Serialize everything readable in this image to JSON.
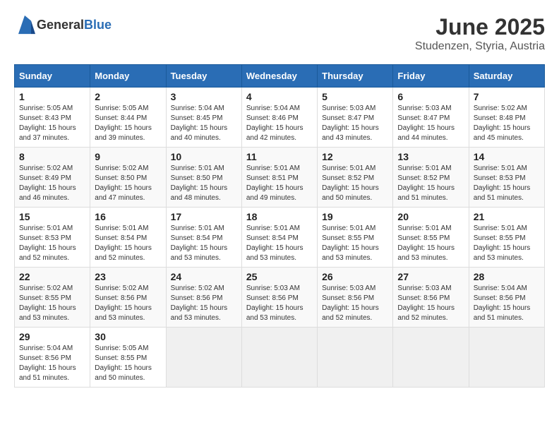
{
  "header": {
    "logo_general": "General",
    "logo_blue": "Blue",
    "month": "June 2025",
    "location": "Studenzen, Styria, Austria"
  },
  "weekdays": [
    "Sunday",
    "Monday",
    "Tuesday",
    "Wednesday",
    "Thursday",
    "Friday",
    "Saturday"
  ],
  "weeks": [
    [
      {
        "day": "1",
        "sunrise": "Sunrise: 5:05 AM",
        "sunset": "Sunset: 8:43 PM",
        "daylight": "Daylight: 15 hours and 37 minutes."
      },
      {
        "day": "2",
        "sunrise": "Sunrise: 5:05 AM",
        "sunset": "Sunset: 8:44 PM",
        "daylight": "Daylight: 15 hours and 39 minutes."
      },
      {
        "day": "3",
        "sunrise": "Sunrise: 5:04 AM",
        "sunset": "Sunset: 8:45 PM",
        "daylight": "Daylight: 15 hours and 40 minutes."
      },
      {
        "day": "4",
        "sunrise": "Sunrise: 5:04 AM",
        "sunset": "Sunset: 8:46 PM",
        "daylight": "Daylight: 15 hours and 42 minutes."
      },
      {
        "day": "5",
        "sunrise": "Sunrise: 5:03 AM",
        "sunset": "Sunset: 8:47 PM",
        "daylight": "Daylight: 15 hours and 43 minutes."
      },
      {
        "day": "6",
        "sunrise": "Sunrise: 5:03 AM",
        "sunset": "Sunset: 8:47 PM",
        "daylight": "Daylight: 15 hours and 44 minutes."
      },
      {
        "day": "7",
        "sunrise": "Sunrise: 5:02 AM",
        "sunset": "Sunset: 8:48 PM",
        "daylight": "Daylight: 15 hours and 45 minutes."
      }
    ],
    [
      {
        "day": "8",
        "sunrise": "Sunrise: 5:02 AM",
        "sunset": "Sunset: 8:49 PM",
        "daylight": "Daylight: 15 hours and 46 minutes."
      },
      {
        "day": "9",
        "sunrise": "Sunrise: 5:02 AM",
        "sunset": "Sunset: 8:50 PM",
        "daylight": "Daylight: 15 hours and 47 minutes."
      },
      {
        "day": "10",
        "sunrise": "Sunrise: 5:01 AM",
        "sunset": "Sunset: 8:50 PM",
        "daylight": "Daylight: 15 hours and 48 minutes."
      },
      {
        "day": "11",
        "sunrise": "Sunrise: 5:01 AM",
        "sunset": "Sunset: 8:51 PM",
        "daylight": "Daylight: 15 hours and 49 minutes."
      },
      {
        "day": "12",
        "sunrise": "Sunrise: 5:01 AM",
        "sunset": "Sunset: 8:52 PM",
        "daylight": "Daylight: 15 hours and 50 minutes."
      },
      {
        "day": "13",
        "sunrise": "Sunrise: 5:01 AM",
        "sunset": "Sunset: 8:52 PM",
        "daylight": "Daylight: 15 hours and 51 minutes."
      },
      {
        "day": "14",
        "sunrise": "Sunrise: 5:01 AM",
        "sunset": "Sunset: 8:53 PM",
        "daylight": "Daylight: 15 hours and 51 minutes."
      }
    ],
    [
      {
        "day": "15",
        "sunrise": "Sunrise: 5:01 AM",
        "sunset": "Sunset: 8:53 PM",
        "daylight": "Daylight: 15 hours and 52 minutes."
      },
      {
        "day": "16",
        "sunrise": "Sunrise: 5:01 AM",
        "sunset": "Sunset: 8:54 PM",
        "daylight": "Daylight: 15 hours and 52 minutes."
      },
      {
        "day": "17",
        "sunrise": "Sunrise: 5:01 AM",
        "sunset": "Sunset: 8:54 PM",
        "daylight": "Daylight: 15 hours and 53 minutes."
      },
      {
        "day": "18",
        "sunrise": "Sunrise: 5:01 AM",
        "sunset": "Sunset: 8:54 PM",
        "daylight": "Daylight: 15 hours and 53 minutes."
      },
      {
        "day": "19",
        "sunrise": "Sunrise: 5:01 AM",
        "sunset": "Sunset: 8:55 PM",
        "daylight": "Daylight: 15 hours and 53 minutes."
      },
      {
        "day": "20",
        "sunrise": "Sunrise: 5:01 AM",
        "sunset": "Sunset: 8:55 PM",
        "daylight": "Daylight: 15 hours and 53 minutes."
      },
      {
        "day": "21",
        "sunrise": "Sunrise: 5:01 AM",
        "sunset": "Sunset: 8:55 PM",
        "daylight": "Daylight: 15 hours and 53 minutes."
      }
    ],
    [
      {
        "day": "22",
        "sunrise": "Sunrise: 5:02 AM",
        "sunset": "Sunset: 8:55 PM",
        "daylight": "Daylight: 15 hours and 53 minutes."
      },
      {
        "day": "23",
        "sunrise": "Sunrise: 5:02 AM",
        "sunset": "Sunset: 8:56 PM",
        "daylight": "Daylight: 15 hours and 53 minutes."
      },
      {
        "day": "24",
        "sunrise": "Sunrise: 5:02 AM",
        "sunset": "Sunset: 8:56 PM",
        "daylight": "Daylight: 15 hours and 53 minutes."
      },
      {
        "day": "25",
        "sunrise": "Sunrise: 5:03 AM",
        "sunset": "Sunset: 8:56 PM",
        "daylight": "Daylight: 15 hours and 53 minutes."
      },
      {
        "day": "26",
        "sunrise": "Sunrise: 5:03 AM",
        "sunset": "Sunset: 8:56 PM",
        "daylight": "Daylight: 15 hours and 52 minutes."
      },
      {
        "day": "27",
        "sunrise": "Sunrise: 5:03 AM",
        "sunset": "Sunset: 8:56 PM",
        "daylight": "Daylight: 15 hours and 52 minutes."
      },
      {
        "day": "28",
        "sunrise": "Sunrise: 5:04 AM",
        "sunset": "Sunset: 8:56 PM",
        "daylight": "Daylight: 15 hours and 51 minutes."
      }
    ],
    [
      {
        "day": "29",
        "sunrise": "Sunrise: 5:04 AM",
        "sunset": "Sunset: 8:56 PM",
        "daylight": "Daylight: 15 hours and 51 minutes."
      },
      {
        "day": "30",
        "sunrise": "Sunrise: 5:05 AM",
        "sunset": "Sunset: 8:55 PM",
        "daylight": "Daylight: 15 hours and 50 minutes."
      },
      null,
      null,
      null,
      null,
      null
    ]
  ]
}
